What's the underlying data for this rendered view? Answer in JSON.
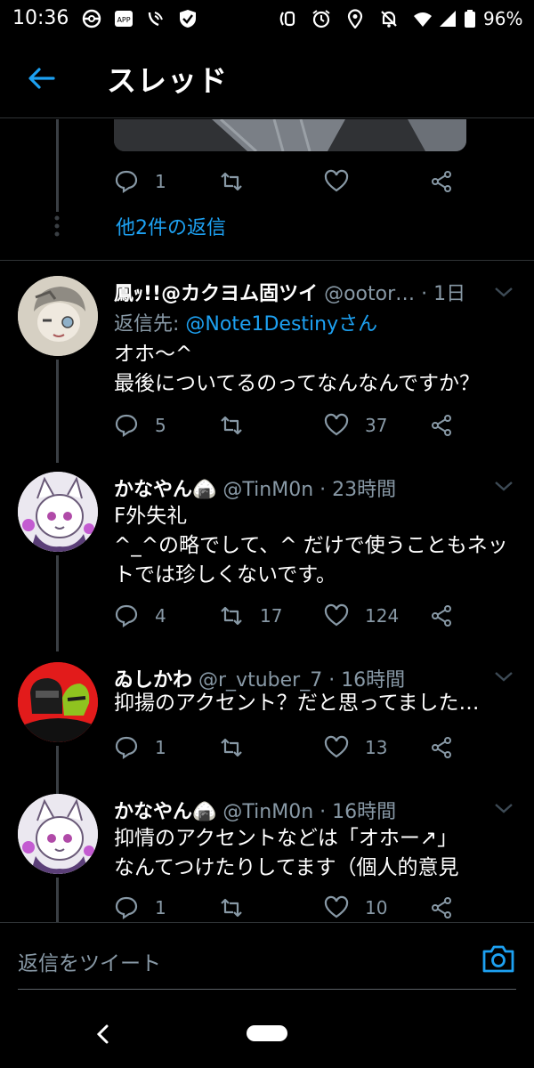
{
  "status_bar": {
    "time": "10:36",
    "battery": "96%"
  },
  "header": {
    "title": "スレッド"
  },
  "top_actions": {
    "reply_count": "1",
    "retweet_count": "",
    "like_count": ""
  },
  "more_replies": "他2件の返信",
  "tweets": [
    {
      "name": "鳳ｯ!!@カクヨム固ツイ",
      "handle": "@ootor…",
      "time": "· 1日",
      "reply_to_prefix": "返信先: ",
      "reply_to_mention": "@Note1Destinyさん",
      "text": "オホ〜^\n最後についてるのってなんなんですか？",
      "replies": "5",
      "retweets": "",
      "likes": "37"
    },
    {
      "name": "かなやん🍙",
      "handle": "@TinM0n",
      "time": "· 23時間",
      "text": "F外失礼\n^_^の略でして、^ だけで使うこともネットでは珍しくないです。",
      "replies": "4",
      "retweets": "17",
      "likes": "124"
    },
    {
      "name": "ゐしかわ",
      "handle": "@r_vtuber_7",
      "time": "· 16時間",
      "text": "抑揚のアクセント？だと思ってました…",
      "replies": "1",
      "retweets": "",
      "likes": "13"
    },
    {
      "name": "かなやん🍙",
      "handle": "@TinM0n",
      "time": "· 16時間",
      "text": "抑情のアクセントなどは「オホー↗」\nなんてつけたりしてます（個人的意見",
      "replies": "1",
      "retweets": "",
      "likes": "10"
    }
  ],
  "reply_box": {
    "placeholder": "返信をツイート"
  },
  "colors": {
    "accent": "#1da1f2",
    "background": "#000000",
    "muted": "#8899a6"
  }
}
